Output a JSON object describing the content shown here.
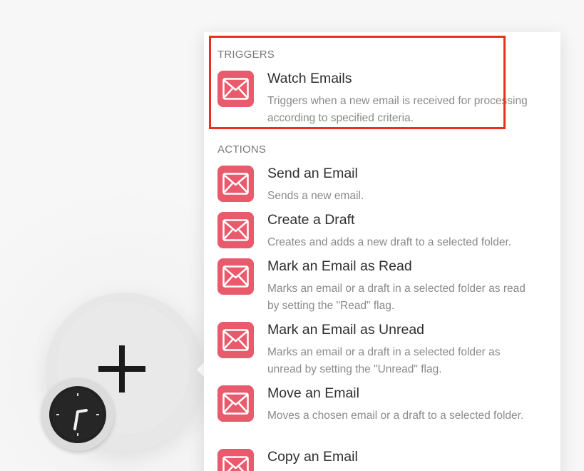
{
  "panel": {
    "triggers_label": "TRIGGERS",
    "actions_label": "ACTIONS",
    "triggers": [
      {
        "title": "Watch Emails",
        "description": "Triggers when a new email is received for processing according to specified criteria."
      }
    ],
    "actions": [
      {
        "title": "Send an Email",
        "description": "Sends a new email."
      },
      {
        "title": "Create a Draft",
        "description": "Creates and adds a new draft to a selected folder."
      },
      {
        "title": "Mark an Email as Read",
        "description": "Marks an email or a draft in a selected folder as read by setting the \"Read\" flag."
      },
      {
        "title": "Mark an Email as Unread",
        "description": "Marks an email or a draft in a selected folder as unread by setting the \"Unread\" flag."
      },
      {
        "title": "Move an Email",
        "description": "Moves a chosen email or a draft to a selected folder."
      },
      {
        "title": "Copy an Email",
        "description": ""
      }
    ]
  },
  "icons": {
    "module_icon": "email-envelope-icon",
    "add_icon": "plus-icon",
    "schedule_icon": "clock-icon"
  },
  "colors": {
    "module_icon_bg": "#e85a6c",
    "highlight_border": "#e8311a"
  }
}
